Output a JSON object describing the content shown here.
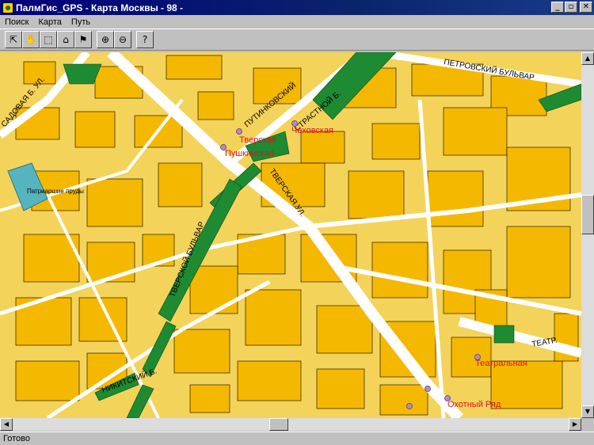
{
  "window": {
    "title": "ПалмГис_GPS - Карта Москвы - 98 -",
    "minimize_glyph": "_",
    "maximize_glyph": "▫",
    "close_glyph": "✕"
  },
  "menu": {
    "items": [
      "Поиск",
      "Карта",
      "Путь"
    ]
  },
  "toolbar": {
    "buttons": [
      {
        "name": "select-tool-icon",
        "glyph": "⇱"
      },
      {
        "name": "pan-hand-icon",
        "glyph": "✋"
      },
      {
        "name": "zoom-window-icon",
        "glyph": "⬚"
      },
      {
        "name": "route-tool-icon",
        "glyph": "⌂"
      },
      {
        "name": "flag-icon",
        "glyph": "⚑"
      },
      {
        "name": "zoom-in-icon",
        "glyph": "⊕"
      },
      {
        "name": "zoom-out-icon",
        "glyph": "⊖"
      },
      {
        "name": "help-icon",
        "glyph": "?"
      }
    ]
  },
  "map": {
    "colors": {
      "land": "#f4d35a",
      "block": "#f5b800",
      "road": "#ffffff",
      "park": "#1e8a32",
      "water": "#55b4c0",
      "poi_text": "#d8141e"
    },
    "streets": [
      "САДОВАЯ Б. УЛ.",
      "ПУТИНКОВСКИЙ",
      "СТРАСТНОЙ Б.",
      "ПЕТРОВСКИЙ БУЛЬВАР",
      "ТВЕРСКАЯ УЛ.",
      "ТВЕРСКОЙ БУЛЬВАР",
      "НИКИТСКИЙ Б.",
      "ТЕАТР."
    ],
    "poi": [
      "Чеховская",
      "Тверская",
      "Пушкинская",
      "Театральная",
      "Охотный Ряд"
    ],
    "water_label": "Патриаршие пруды"
  },
  "status": {
    "text": "Готово"
  },
  "scroll": {
    "up": "▲",
    "down": "▼",
    "left": "◀",
    "right": "▶"
  }
}
